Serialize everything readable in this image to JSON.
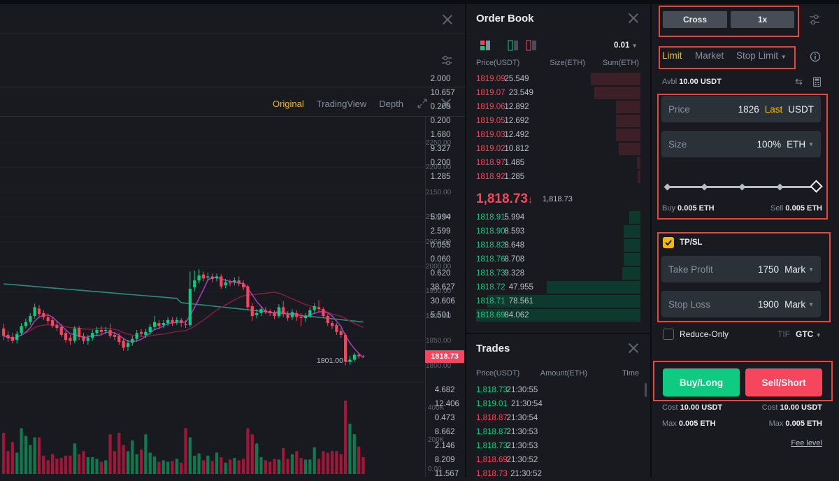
{
  "chart": {
    "tabs": [
      {
        "label": "Original",
        "active": true
      },
      {
        "label": "TradingView",
        "active": false
      },
      {
        "label": "Depth",
        "active": false
      }
    ],
    "price_axis": [
      "2250.00",
      "2200.00",
      "2150.00",
      "2100.00",
      "2050.00",
      "2000.00",
      "1950.00",
      "1900.00",
      "1850.00",
      "1800.00"
    ],
    "volume_axis": [
      "400K",
      "200K",
      "0.00"
    ],
    "last_price_tag": "1818.73",
    "low_marker": "1801.00",
    "colors": {
      "up": "#0ecb81",
      "down": "#f6465d",
      "vol_up": "#0e7a50",
      "vol_down": "#a3163a",
      "ma_short": "#a23cb4",
      "ma_mid": "#7a1f3f",
      "ma_long": "#2b8b84"
    }
  },
  "chart_data": {
    "type": "candlestick",
    "ylim": [
      1800,
      2260
    ],
    "candles": [
      [
        1875,
        1860,
        1885,
        1852
      ],
      [
        1862,
        1855,
        1870,
        1848
      ],
      [
        1858,
        1850,
        1866,
        1845
      ],
      [
        1852,
        1864,
        1870,
        1845
      ],
      [
        1866,
        1880,
        1886,
        1860
      ],
      [
        1880,
        1888,
        1895,
        1875
      ],
      [
        1888,
        1900,
        1906,
        1882
      ],
      [
        1900,
        1918,
        1925,
        1895
      ],
      [
        1915,
        1904,
        1922,
        1898
      ],
      [
        1906,
        1898,
        1912,
        1892
      ],
      [
        1898,
        1890,
        1905,
        1884
      ],
      [
        1892,
        1880,
        1898,
        1876
      ],
      [
        1882,
        1876,
        1890,
        1870
      ],
      [
        1878,
        1862,
        1884,
        1858
      ],
      [
        1866,
        1852,
        1870,
        1846
      ],
      [
        1856,
        1850,
        1862,
        1842
      ],
      [
        1850,
        1875,
        1880,
        1845
      ],
      [
        1876,
        1858,
        1880,
        1852
      ],
      [
        1860,
        1850,
        1866,
        1844
      ],
      [
        1850,
        1856,
        1862,
        1842
      ],
      [
        1856,
        1866,
        1872,
        1850
      ],
      [
        1866,
        1872,
        1878,
        1860
      ],
      [
        1872,
        1868,
        1880,
        1862
      ],
      [
        1870,
        1872,
        1878,
        1864
      ],
      [
        1872,
        1860,
        1885,
        1855
      ],
      [
        1862,
        1858,
        1868,
        1852
      ],
      [
        1860,
        1848,
        1866,
        1842
      ],
      [
        1850,
        1836,
        1856,
        1830
      ],
      [
        1838,
        1846,
        1852,
        1830
      ],
      [
        1846,
        1854,
        1860,
        1840
      ],
      [
        1854,
        1866,
        1872,
        1848
      ],
      [
        1868,
        1864,
        1874,
        1858
      ],
      [
        1862,
        1868,
        1874,
        1856
      ],
      [
        1868,
        1878,
        1884,
        1862
      ],
      [
        1878,
        1888,
        1900,
        1872
      ],
      [
        1886,
        1880,
        1892,
        1874
      ],
      [
        1882,
        1886,
        1892,
        1876
      ],
      [
        1886,
        1892,
        1898,
        1880
      ],
      [
        1892,
        1886,
        1898,
        1880
      ],
      [
        1888,
        1892,
        1898,
        1882
      ],
      [
        1892,
        1886,
        1896,
        1878
      ],
      [
        1884,
        1882,
        1892,
        1876
      ],
      [
        1882,
        1955,
        1990,
        1878
      ],
      [
        1958,
        1972,
        1992,
        1950
      ],
      [
        1972,
        1982,
        1995,
        1966
      ],
      [
        1984,
        1976,
        1990,
        1970
      ],
      [
        1978,
        1980,
        1988,
        1972
      ],
      [
        1980,
        1975,
        1986,
        1968
      ],
      [
        1976,
        1980,
        1986,
        1970
      ],
      [
        1980,
        1960,
        1985,
        1955
      ],
      [
        1962,
        1968,
        1975,
        1956
      ],
      [
        1968,
        1966,
        1974,
        1960
      ],
      [
        1968,
        1972,
        1978,
        1962
      ],
      [
        1972,
        1966,
        1980,
        1960
      ],
      [
        1966,
        1958,
        1972,
        1952
      ],
      [
        1960,
        1918,
        1964,
        1912
      ],
      [
        1920,
        1900,
        1926,
        1890
      ],
      [
        1902,
        1906,
        1914,
        1895
      ],
      [
        1906,
        1914,
        1920,
        1900
      ],
      [
        1912,
        1908,
        1918,
        1904
      ],
      [
        1910,
        1906,
        1914,
        1900
      ],
      [
        1906,
        1900,
        1912,
        1894
      ],
      [
        1900,
        1918,
        1924,
        1896
      ],
      [
        1918,
        1904,
        1930,
        1898
      ],
      [
        1904,
        1896,
        1910,
        1890
      ],
      [
        1898,
        1908,
        1914,
        1892
      ],
      [
        1906,
        1898,
        1912,
        1890
      ],
      [
        1898,
        1896,
        1906,
        1880
      ],
      [
        1896,
        1900,
        1906,
        1888
      ],
      [
        1900,
        1912,
        1918,
        1896
      ],
      [
        1912,
        1920,
        1926,
        1906
      ],
      [
        1918,
        1914,
        1932,
        1908
      ],
      [
        1914,
        1900,
        1918,
        1896
      ],
      [
        1900,
        1886,
        1904,
        1880
      ],
      [
        1886,
        1880,
        1890,
        1874
      ],
      [
        1882,
        1868,
        1886,
        1862
      ],
      [
        1870,
        1862,
        1876,
        1856
      ],
      [
        1862,
        1808,
        1866,
        1801
      ],
      [
        1808,
        1812,
        1820,
        1802
      ],
      [
        1812,
        1822,
        1826,
        1808
      ],
      [
        1822,
        1819,
        1826,
        1814
      ],
      [
        1819,
        1818.73,
        1822,
        1816
      ]
    ],
    "volumes_k": [
      270,
      150,
      210,
      140,
      300,
      250,
      190,
      240,
      240,
      120,
      90,
      130,
      100,
      105,
      120,
      120,
      200,
      130,
      150,
      110,
      110,
      100,
      80,
      90,
      260,
      150,
      270,
      190,
      150,
      220,
      130,
      160,
      260,
      140,
      115,
      80,
      90,
      80,
      85,
      100,
      75,
      300,
      240,
      120,
      135,
      90,
      120,
      85,
      140,
      110,
      75,
      95,
      105,
      90,
      100,
      300,
      260,
      200,
      110,
      90,
      80,
      100,
      95,
      170,
      100,
      130,
      150,
      105,
      95,
      95,
      175,
      100,
      150,
      140,
      150,
      150,
      130,
      480,
      330,
      260,
      180,
      110
    ],
    "volume_ylim": [
      0,
      500
    ],
    "volume_ticks": [
      "400K",
      "200K",
      "0.00"
    ]
  },
  "order_book": {
    "title": "Order Book",
    "precision": "0.01",
    "headers": [
      "Price(USDT)",
      "Size(ETH)",
      "Sum(ETH)"
    ],
    "asks": [
      {
        "price": "1819.09",
        "size": "2.000",
        "sum": "25.549",
        "depth": 0.3
      },
      {
        "price": "1819.07",
        "size": "10.657",
        "sum": "23.549",
        "depth": 0.28
      },
      {
        "price": "1819.06",
        "size": "0.200",
        "sum": "12.892",
        "depth": 0.15
      },
      {
        "price": "1819.05",
        "size": "0.200",
        "sum": "12.692",
        "depth": 0.15
      },
      {
        "price": "1819.03",
        "size": "1.680",
        "sum": "12.492",
        "depth": 0.15
      },
      {
        "price": "1819.02",
        "size": "9.327",
        "sum": "10.812",
        "depth": 0.13
      },
      {
        "price": "1818.97",
        "size": "0.200",
        "sum": "1.485",
        "depth": 0.02
      },
      {
        "price": "1818.92",
        "size": "1.285",
        "sum": "1.285",
        "depth": 0.015
      }
    ],
    "last_price": "1,818.73",
    "last_arrow": "↓",
    "mark_price": "1,818.73",
    "bids": [
      {
        "price": "1818.91",
        "size": "5.994",
        "sum": "5.994",
        "depth": 0.07
      },
      {
        "price": "1818.90",
        "size": "2.599",
        "sum": "8.593",
        "depth": 0.1
      },
      {
        "price": "1818.82",
        "size": "0.055",
        "sum": "8.648",
        "depth": 0.1
      },
      {
        "price": "1818.76",
        "size": "0.060",
        "sum": "8.708",
        "depth": 0.1
      },
      {
        "price": "1818.73",
        "size": "0.620",
        "sum": "9.328",
        "depth": 0.11
      },
      {
        "price": "1818.72",
        "size": "38.627",
        "sum": "47.955",
        "depth": 0.57
      },
      {
        "price": "1818.71",
        "size": "30.606",
        "sum": "78.561",
        "depth": 0.93
      },
      {
        "price": "1818.69",
        "size": "5.501",
        "sum": "84.062",
        "depth": 1.0
      }
    ]
  },
  "trades": {
    "title": "Trades",
    "headers": [
      "Price(USDT)",
      "Amount(ETH)",
      "Time"
    ],
    "rows": [
      {
        "price": "1,818.73",
        "amount": "4.682",
        "time": "21:30:55",
        "side": "buy"
      },
      {
        "price": "1,819.01",
        "amount": "12.406",
        "time": "21:30:54",
        "side": "buy"
      },
      {
        "price": "1,818.87",
        "amount": "0.473",
        "time": "21:30:54",
        "side": "sell"
      },
      {
        "price": "1,818.87",
        "amount": "8.662",
        "time": "21:30:53",
        "side": "buy"
      },
      {
        "price": "1,818.73",
        "amount": "2.146",
        "time": "21:30:53",
        "side": "buy"
      },
      {
        "price": "1,818.69",
        "amount": "8.209",
        "time": "21:30:52",
        "side": "sell"
      },
      {
        "price": "1,818.73",
        "amount": "11.567",
        "time": "21:30:52",
        "side": "sell"
      }
    ]
  },
  "order_form": {
    "margin_mode": "Cross",
    "leverage": "1x",
    "order_types": [
      "Limit",
      "Market",
      "Stop Limit"
    ],
    "active_order_type": "Limit",
    "avbl_label": "Avbl",
    "avbl_value": "10.00 USDT",
    "price": {
      "label": "Price",
      "value": "1826",
      "tag": "Last",
      "unit": "USDT"
    },
    "size": {
      "label": "Size",
      "value": "100%",
      "unit": "ETH"
    },
    "slider_percent": 100,
    "buy_label": "Buy",
    "buy_value": "0.005 ETH",
    "sell_label": "Sell",
    "sell_value": "0.005 ETH",
    "tpsl": {
      "label": "TP/SL",
      "checked": true
    },
    "take_profit": {
      "label": "Take Profit",
      "value": "1750",
      "trigger": "Mark"
    },
    "stop_loss": {
      "label": "Stop Loss",
      "value": "1900",
      "trigger": "Mark"
    },
    "reduce_only": {
      "label": "Reduce-Only",
      "checked": false
    },
    "tif_label": "TIF",
    "tif_value": "GTC",
    "buy_button": "Buy/Long",
    "sell_button": "Sell/Short",
    "cost_label": "Cost",
    "buy_cost": "10.00 USDT",
    "sell_cost": "10.00 USDT",
    "max_label": "Max",
    "buy_max": "0.005 ETH",
    "sell_max": "0.005 ETH",
    "fee_level": "Fee level"
  }
}
